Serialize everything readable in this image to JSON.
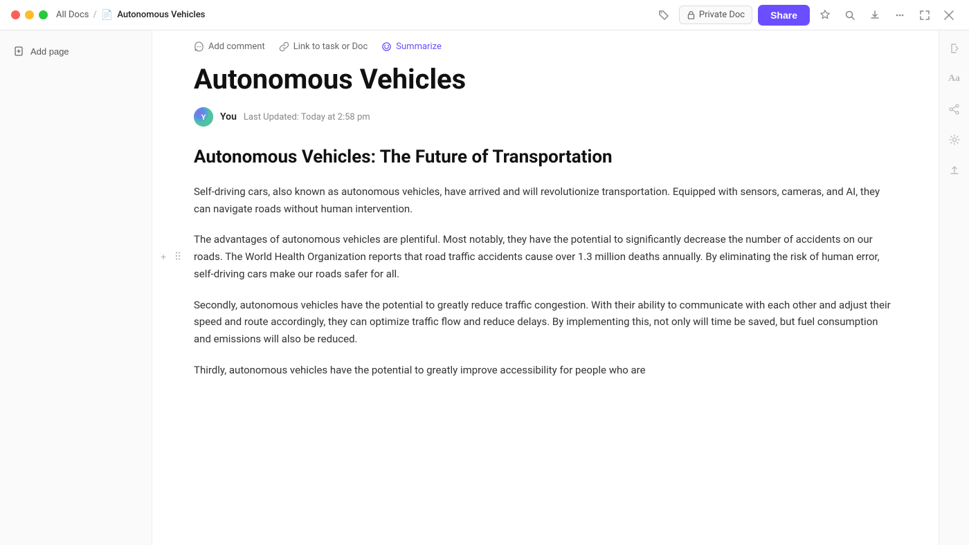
{
  "titleBar": {
    "breadcrumb": {
      "allDocs": "All Docs",
      "separator": "/",
      "current": "Autonomous Vehicles"
    },
    "privateBadge": "Private Doc",
    "shareLabel": "Share",
    "icons": {
      "tag": "🏷",
      "star": "☆",
      "search": "⌕",
      "export": "↓",
      "more": "···",
      "expand": "⤢",
      "close": "✕"
    }
  },
  "sidebar": {
    "addPageLabel": "Add page"
  },
  "toolbar": {
    "addComment": "Add comment",
    "linkToTask": "Link to task or Doc",
    "summarize": "Summarize"
  },
  "doc": {
    "title": "Autonomous Vehicles",
    "author": "You",
    "lastUpdated": "Last Updated: Today at 2:58 pm",
    "heading": "Autonomous Vehicles: The Future of Transportation",
    "paragraphs": [
      "Self-driving cars, also known as autonomous vehicles, have arrived and will revolutionize transportation. Equipped with sensors, cameras, and AI, they can navigate roads without human intervention.",
      "The advantages of autonomous vehicles are plentiful. Most notably, they have the potential to significantly decrease the number of accidents on our roads. The World Health Organization reports that road traffic accidents cause over 1.3 million deaths annually. By eliminating the risk of human error, self-driving cars make our roads safer for all.",
      "Secondly, autonomous vehicles have the potential to greatly reduce traffic congestion. With their ability to communicate with each other and adjust their speed and route accordingly, they can optimize traffic flow and reduce delays. By implementing this, not only will time be saved, but fuel consumption and emissions will also be reduced.",
      "Thirdly, autonomous vehicles have the potential to greatly improve accessibility for people who are"
    ]
  },
  "rightSidebar": {
    "icons": [
      "⇤",
      "Aa",
      "⇪",
      "⚙",
      "⬆"
    ]
  }
}
